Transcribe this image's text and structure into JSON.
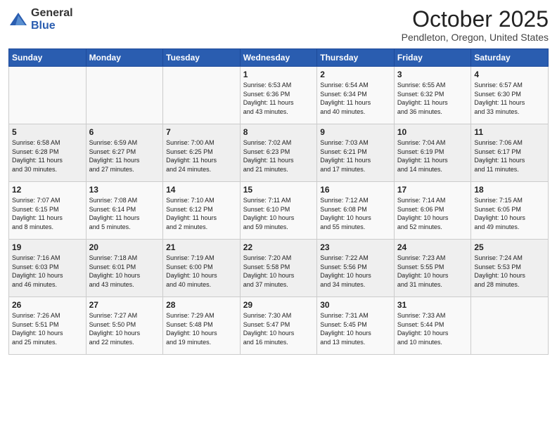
{
  "header": {
    "logo_general": "General",
    "logo_blue": "Blue",
    "month": "October 2025",
    "location": "Pendleton, Oregon, United States"
  },
  "weekdays": [
    "Sunday",
    "Monday",
    "Tuesday",
    "Wednesday",
    "Thursday",
    "Friday",
    "Saturday"
  ],
  "weeks": [
    [
      {
        "day": "",
        "info": ""
      },
      {
        "day": "",
        "info": ""
      },
      {
        "day": "",
        "info": ""
      },
      {
        "day": "1",
        "info": "Sunrise: 6:53 AM\nSunset: 6:36 PM\nDaylight: 11 hours\nand 43 minutes."
      },
      {
        "day": "2",
        "info": "Sunrise: 6:54 AM\nSunset: 6:34 PM\nDaylight: 11 hours\nand 40 minutes."
      },
      {
        "day": "3",
        "info": "Sunrise: 6:55 AM\nSunset: 6:32 PM\nDaylight: 11 hours\nand 36 minutes."
      },
      {
        "day": "4",
        "info": "Sunrise: 6:57 AM\nSunset: 6:30 PM\nDaylight: 11 hours\nand 33 minutes."
      }
    ],
    [
      {
        "day": "5",
        "info": "Sunrise: 6:58 AM\nSunset: 6:28 PM\nDaylight: 11 hours\nand 30 minutes."
      },
      {
        "day": "6",
        "info": "Sunrise: 6:59 AM\nSunset: 6:27 PM\nDaylight: 11 hours\nand 27 minutes."
      },
      {
        "day": "7",
        "info": "Sunrise: 7:00 AM\nSunset: 6:25 PM\nDaylight: 11 hours\nand 24 minutes."
      },
      {
        "day": "8",
        "info": "Sunrise: 7:02 AM\nSunset: 6:23 PM\nDaylight: 11 hours\nand 21 minutes."
      },
      {
        "day": "9",
        "info": "Sunrise: 7:03 AM\nSunset: 6:21 PM\nDaylight: 11 hours\nand 17 minutes."
      },
      {
        "day": "10",
        "info": "Sunrise: 7:04 AM\nSunset: 6:19 PM\nDaylight: 11 hours\nand 14 minutes."
      },
      {
        "day": "11",
        "info": "Sunrise: 7:06 AM\nSunset: 6:17 PM\nDaylight: 11 hours\nand 11 minutes."
      }
    ],
    [
      {
        "day": "12",
        "info": "Sunrise: 7:07 AM\nSunset: 6:15 PM\nDaylight: 11 hours\nand 8 minutes."
      },
      {
        "day": "13",
        "info": "Sunrise: 7:08 AM\nSunset: 6:14 PM\nDaylight: 11 hours\nand 5 minutes."
      },
      {
        "day": "14",
        "info": "Sunrise: 7:10 AM\nSunset: 6:12 PM\nDaylight: 11 hours\nand 2 minutes."
      },
      {
        "day": "15",
        "info": "Sunrise: 7:11 AM\nSunset: 6:10 PM\nDaylight: 10 hours\nand 59 minutes."
      },
      {
        "day": "16",
        "info": "Sunrise: 7:12 AM\nSunset: 6:08 PM\nDaylight: 10 hours\nand 55 minutes."
      },
      {
        "day": "17",
        "info": "Sunrise: 7:14 AM\nSunset: 6:06 PM\nDaylight: 10 hours\nand 52 minutes."
      },
      {
        "day": "18",
        "info": "Sunrise: 7:15 AM\nSunset: 6:05 PM\nDaylight: 10 hours\nand 49 minutes."
      }
    ],
    [
      {
        "day": "19",
        "info": "Sunrise: 7:16 AM\nSunset: 6:03 PM\nDaylight: 10 hours\nand 46 minutes."
      },
      {
        "day": "20",
        "info": "Sunrise: 7:18 AM\nSunset: 6:01 PM\nDaylight: 10 hours\nand 43 minutes."
      },
      {
        "day": "21",
        "info": "Sunrise: 7:19 AM\nSunset: 6:00 PM\nDaylight: 10 hours\nand 40 minutes."
      },
      {
        "day": "22",
        "info": "Sunrise: 7:20 AM\nSunset: 5:58 PM\nDaylight: 10 hours\nand 37 minutes."
      },
      {
        "day": "23",
        "info": "Sunrise: 7:22 AM\nSunset: 5:56 PM\nDaylight: 10 hours\nand 34 minutes."
      },
      {
        "day": "24",
        "info": "Sunrise: 7:23 AM\nSunset: 5:55 PM\nDaylight: 10 hours\nand 31 minutes."
      },
      {
        "day": "25",
        "info": "Sunrise: 7:24 AM\nSunset: 5:53 PM\nDaylight: 10 hours\nand 28 minutes."
      }
    ],
    [
      {
        "day": "26",
        "info": "Sunrise: 7:26 AM\nSunset: 5:51 PM\nDaylight: 10 hours\nand 25 minutes."
      },
      {
        "day": "27",
        "info": "Sunrise: 7:27 AM\nSunset: 5:50 PM\nDaylight: 10 hours\nand 22 minutes."
      },
      {
        "day": "28",
        "info": "Sunrise: 7:29 AM\nSunset: 5:48 PM\nDaylight: 10 hours\nand 19 minutes."
      },
      {
        "day": "29",
        "info": "Sunrise: 7:30 AM\nSunset: 5:47 PM\nDaylight: 10 hours\nand 16 minutes."
      },
      {
        "day": "30",
        "info": "Sunrise: 7:31 AM\nSunset: 5:45 PM\nDaylight: 10 hours\nand 13 minutes."
      },
      {
        "day": "31",
        "info": "Sunrise: 7:33 AM\nSunset: 5:44 PM\nDaylight: 10 hours\nand 10 minutes."
      },
      {
        "day": "",
        "info": ""
      }
    ]
  ]
}
